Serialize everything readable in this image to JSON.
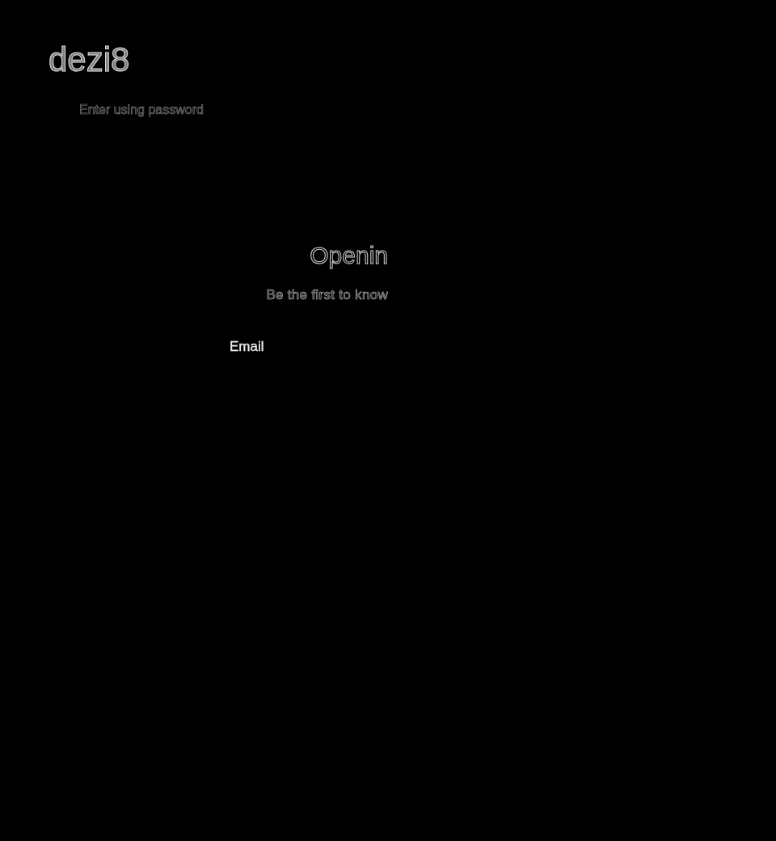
{
  "header": {
    "logo": "dezi8",
    "password_link": "Enter using password"
  },
  "main": {
    "heading": "Openin",
    "subtitle": "Be the first to know",
    "email_label": "Email"
  }
}
